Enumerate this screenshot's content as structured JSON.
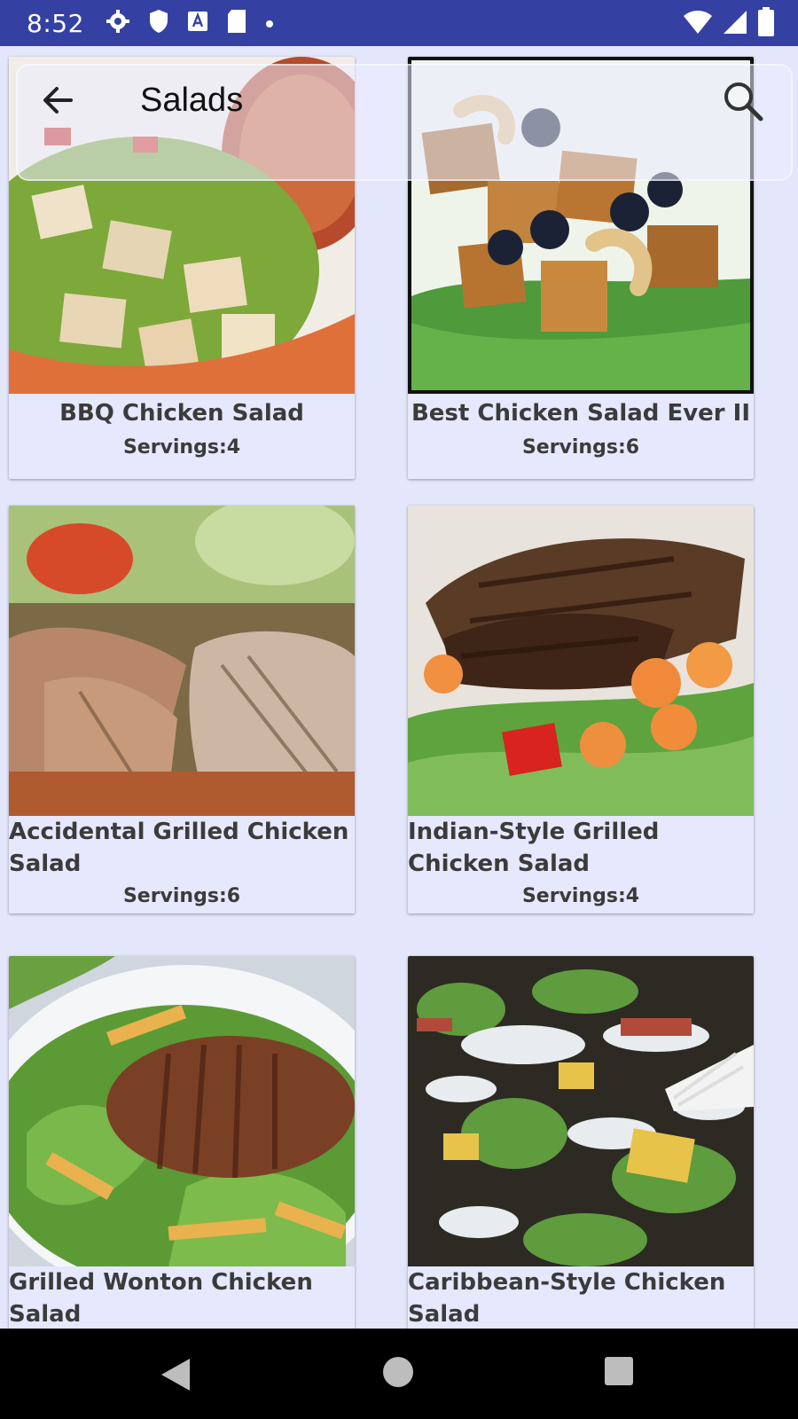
{
  "status_bar": {
    "time": "8:52",
    "left_icons": [
      "gear-icon",
      "shield-icon",
      "a-box-icon",
      "sd-card-icon",
      "dot-icon"
    ],
    "right_icons": [
      "wifi-icon",
      "signal-icon",
      "battery-icon"
    ]
  },
  "app_bar": {
    "title": "Salads",
    "back_icon": "arrow-left-icon",
    "search_icon": "search-icon"
  },
  "recipes": [
    {
      "title": "BBQ Chicken Salad",
      "servings": "Servings:4"
    },
    {
      "title": "Best Chicken Salad Ever II",
      "servings": "Servings:6"
    },
    {
      "title": "Accidental Grilled Chicken Salad",
      "servings": "Servings:6"
    },
    {
      "title": "Indian-Style Grilled Chicken Salad",
      "servings": "Servings:4"
    },
    {
      "title": "Grilled Wonton Chicken Salad",
      "servings": ""
    },
    {
      "title": "Caribbean-Style Chicken Salad",
      "servings": ""
    }
  ],
  "nav_bar": {
    "icons": [
      "nav-back-icon",
      "nav-home-icon",
      "nav-recents-icon"
    ]
  },
  "colors": {
    "status_bar": "#3441a3",
    "background": "#e4e6fb",
    "card": "#e6e8fd",
    "text": "#3b3b3b"
  }
}
